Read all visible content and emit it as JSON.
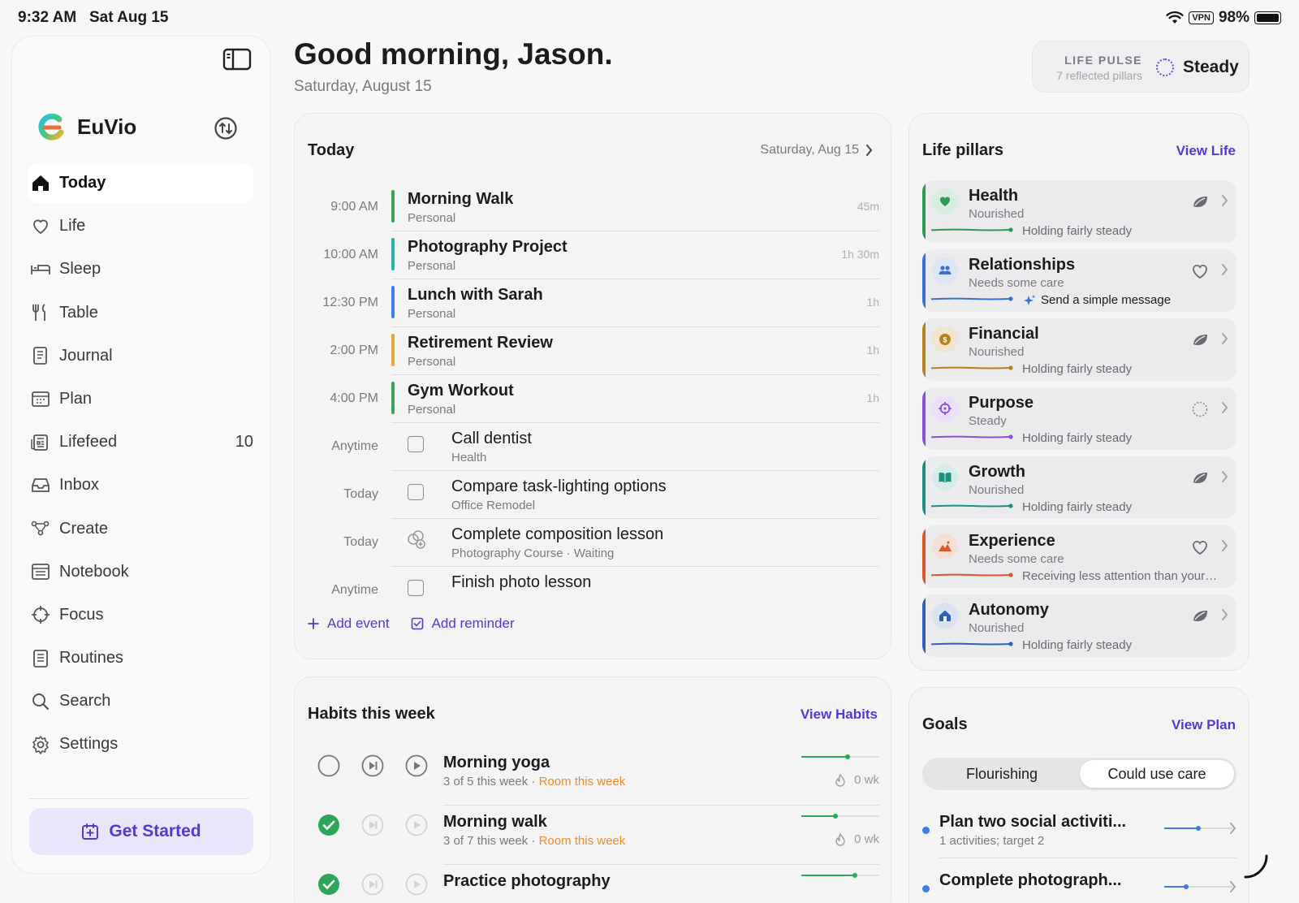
{
  "status_bar": {
    "time": "9:32 AM",
    "date": "Sat Aug 15",
    "vpn": "VPN",
    "battery": "98%"
  },
  "sidebar": {
    "app_name": "EuVio",
    "nav": [
      {
        "label": "Today",
        "icon": "home-icon",
        "active": true
      },
      {
        "label": "Life",
        "icon": "heart-icon"
      },
      {
        "label": "Sleep",
        "icon": "bed-icon"
      },
      {
        "label": "Table",
        "icon": "utensils-icon"
      },
      {
        "label": "Journal",
        "icon": "journal-icon"
      },
      {
        "label": "Plan",
        "icon": "calendar-icon"
      },
      {
        "label": "Lifefeed",
        "icon": "newspaper-icon",
        "count": "10"
      },
      {
        "label": "Inbox",
        "icon": "inbox-icon"
      },
      {
        "label": "Create",
        "icon": "nodes-icon"
      },
      {
        "label": "Notebook",
        "icon": "notebook-icon"
      },
      {
        "label": "Focus",
        "icon": "crosshair-icon"
      },
      {
        "label": "Routines",
        "icon": "checklist-icon"
      },
      {
        "label": "Search",
        "icon": "search-icon"
      },
      {
        "label": "Settings",
        "icon": "gear-icon"
      }
    ],
    "cta": "Get Started"
  },
  "header": {
    "greeting": "Good morning, Jason.",
    "date": "Saturday, August 15",
    "pulse_label": "LIFE PULSE",
    "pulse_sub": "7 reflected pillars",
    "pulse_value": "Steady"
  },
  "today": {
    "title": "Today",
    "date": "Saturday, Aug 15",
    "events": [
      {
        "time": "9:00 AM",
        "title": "Morning Walk",
        "sub": "Personal",
        "dur": "45m",
        "color": "#3aa55d"
      },
      {
        "time": "10:00 AM",
        "title": "Photography Project",
        "sub": "Personal",
        "dur": "1h 30m",
        "color": "#28b3a8"
      },
      {
        "time": "12:30 PM",
        "title": "Lunch with Sarah",
        "sub": "Personal",
        "dur": "1h",
        "color": "#3b82e6"
      },
      {
        "time": "2:00 PM",
        "title": "Retirement Review",
        "sub": "Personal",
        "dur": "1h",
        "color": "#e9a63a"
      },
      {
        "time": "4:00 PM",
        "title": "Gym Workout",
        "sub": "Personal",
        "dur": "1h",
        "color": "#3aa55d"
      }
    ],
    "tasks": [
      {
        "when": "Anytime",
        "title": "Call dentist",
        "sub": "Health",
        "kind": "checkbox"
      },
      {
        "when": "Today",
        "title": "Compare task-lighting options",
        "sub": "Office Remodel",
        "kind": "checkbox"
      },
      {
        "when": "Today",
        "title": "Complete composition lesson",
        "sub": "Photography Course · Waiting",
        "kind": "waiting"
      },
      {
        "when": "Anytime",
        "title": "Finish photo lesson",
        "sub": "",
        "kind": "checkbox"
      }
    ],
    "add_event": "Add event",
    "add_reminder": "Add reminder"
  },
  "habits": {
    "title": "Habits this week",
    "link": "View Habits",
    "items": [
      {
        "title": "Morning yoga",
        "progress": "3 of 5 this week",
        "note": "Room this week",
        "streak": "0 wk",
        "done": false,
        "fraction": 0.6
      },
      {
        "title": "Morning walk",
        "progress": "3 of 7 this week",
        "note": "Room this week",
        "streak": "0 wk",
        "done": true,
        "fraction": 0.43
      },
      {
        "title": "Practice photography",
        "progress": "",
        "note": "",
        "streak": "",
        "done": true,
        "fraction": 0.7
      }
    ]
  },
  "pillars": {
    "title": "Life pillars",
    "link": "View Life",
    "items": [
      {
        "name": "Health",
        "state": "Nourished",
        "note": "Holding fairly steady",
        "color": "#2e9b55",
        "bg": "#d9eedf",
        "icon": "heart-icon",
        "status_icon": "leaf-icon"
      },
      {
        "name": "Relationships",
        "state": "Needs some care",
        "note": "Send a simple message",
        "color": "#3b6fd8",
        "bg": "#dde6f7",
        "icon": "people-icon",
        "status_icon": "heart-outline-icon",
        "suggestion": true
      },
      {
        "name": "Financial",
        "state": "Nourished",
        "note": "Holding fairly steady",
        "color": "#b5811f",
        "bg": "#f2e5cc",
        "icon": "coin-icon",
        "status_icon": "leaf-icon"
      },
      {
        "name": "Purpose",
        "state": "Steady",
        "note": "Holding fairly steady",
        "color": "#8b4fd8",
        "bg": "#ebdff9",
        "icon": "crosshair-icon",
        "status_icon": "ring-icon"
      },
      {
        "name": "Growth",
        "state": "Nourished",
        "note": "Holding fairly steady",
        "color": "#1f8f83",
        "bg": "#d6ece9",
        "icon": "book-icon",
        "status_icon": "leaf-icon"
      },
      {
        "name": "Experience",
        "state": "Needs some care",
        "note": "Receiving less attention than your…",
        "color": "#d9582b",
        "bg": "#f6dfd4",
        "icon": "mountain-icon",
        "status_icon": "heart-outline-icon"
      },
      {
        "name": "Autonomy",
        "state": "Nourished",
        "note": "Holding fairly steady",
        "color": "#2f5fb8",
        "bg": "#dbe3f3",
        "icon": "house-icon",
        "status_icon": "leaf-icon"
      }
    ]
  },
  "goals": {
    "title": "Goals",
    "link": "View Plan",
    "segments": [
      "Flourishing",
      "Could use care"
    ],
    "selected": 1,
    "items": [
      {
        "title": "Plan two social activiti...",
        "sub": "1 activities; target 2",
        "progress": 0.5
      },
      {
        "title": "Complete photograph...",
        "sub": "",
        "progress": 0.3
      }
    ]
  }
}
